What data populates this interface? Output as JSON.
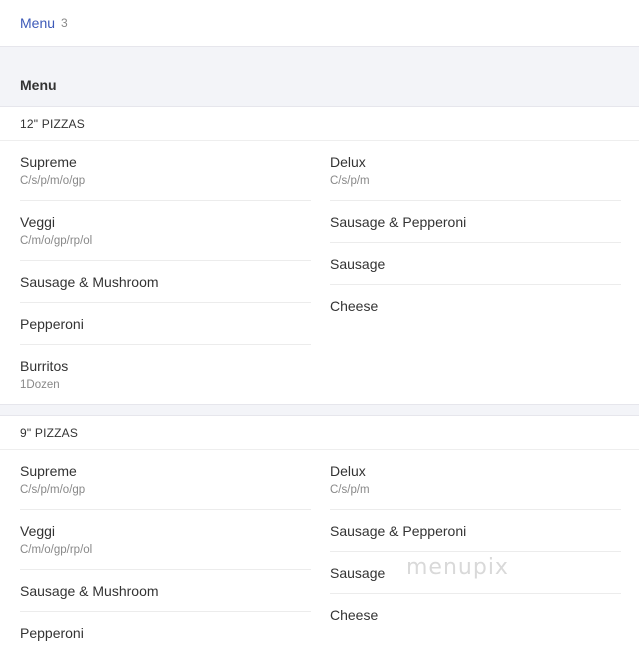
{
  "breadcrumb": {
    "link": "Menu",
    "count": "3"
  },
  "menu_heading": "Menu",
  "sections": [
    {
      "title": "12\" PIZZAS",
      "left": [
        {
          "name": "Supreme",
          "desc": "C/s/p/m/o/gp"
        },
        {
          "name": "Veggi",
          "desc": "C/m/o/gp/rp/ol"
        },
        {
          "name": "Sausage & Mushroom",
          "desc": ""
        },
        {
          "name": "Pepperoni",
          "desc": ""
        },
        {
          "name": "Burritos",
          "desc": "1Dozen"
        }
      ],
      "right": [
        {
          "name": "Delux",
          "desc": "C/s/p/m"
        },
        {
          "name": "Sausage & Pepperoni",
          "desc": ""
        },
        {
          "name": "Sausage",
          "desc": ""
        },
        {
          "name": "Cheese",
          "desc": ""
        }
      ]
    },
    {
      "title": "9\" PIZZAS",
      "left": [
        {
          "name": "Supreme",
          "desc": "C/s/p/m/o/gp"
        },
        {
          "name": "Veggi",
          "desc": "C/m/o/gp/rp/ol"
        },
        {
          "name": "Sausage & Mushroom",
          "desc": ""
        },
        {
          "name": "Pepperoni",
          "desc": ""
        }
      ],
      "right": [
        {
          "name": "Delux",
          "desc": "C/s/p/m"
        },
        {
          "name": "Sausage & Pepperoni",
          "desc": ""
        },
        {
          "name": "Sausage",
          "desc": ""
        },
        {
          "name": "Cheese",
          "desc": ""
        }
      ]
    }
  ],
  "watermark": "menupix"
}
